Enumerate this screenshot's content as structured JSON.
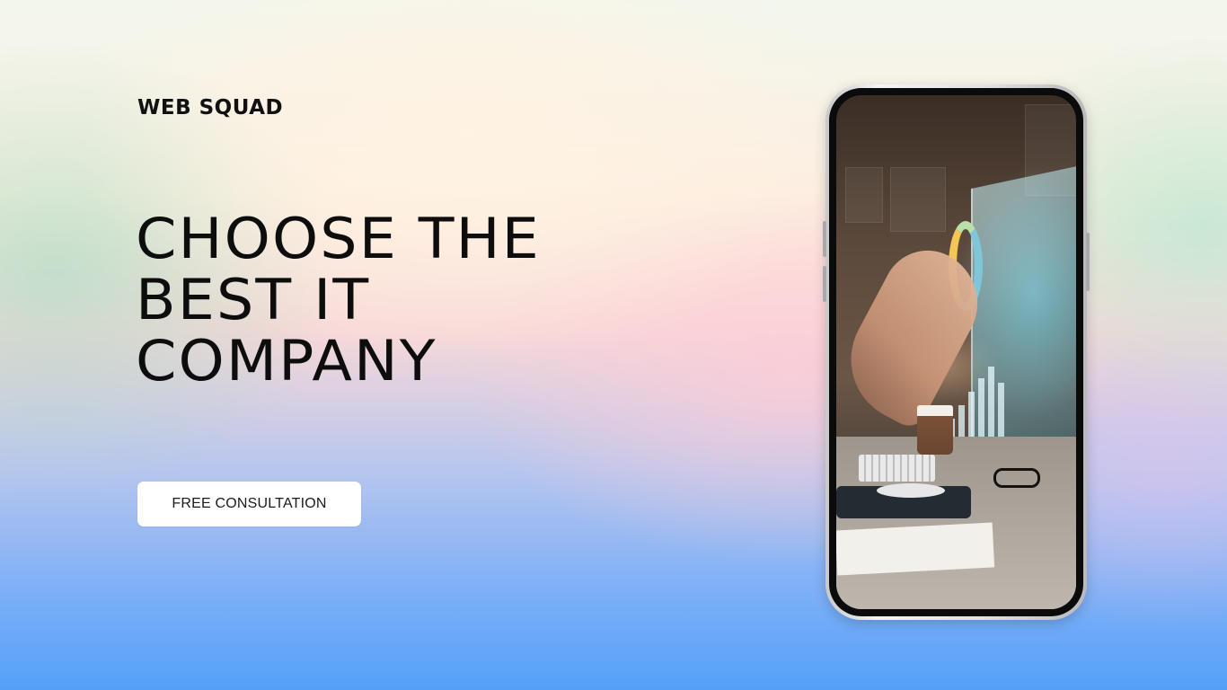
{
  "brand": {
    "name": "WEB SQUAD"
  },
  "hero": {
    "headline_lines": [
      "CHOOSE THE",
      "BEST IT",
      "COMPANY"
    ],
    "cta_label": "FREE CONSULTATION"
  },
  "phone": {
    "screen_image": "person-touching-holographic-data-display"
  },
  "colors": {
    "text": "#111111",
    "button_bg": "#ffffff",
    "gradient_bottom": "#55a0fa",
    "gradient_top": "#f2f7ee"
  }
}
